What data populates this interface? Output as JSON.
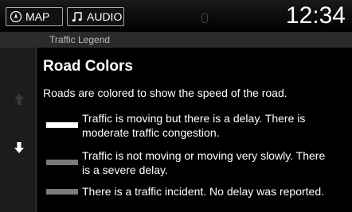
{
  "header": {
    "map_tab": {
      "label": "MAP",
      "icon": "compass-icon"
    },
    "audio_tab": {
      "label": "AUDIO",
      "icon": "music-note-icon"
    },
    "clock": "12:34"
  },
  "breadcrumb": "Traffic Legend",
  "content": {
    "heading": "Road Colors",
    "intro": "Roads are colored to show the speed of the road.",
    "legend": [
      {
        "color": "#ffffff",
        "line1": "Traffic is moving but there is a delay. There is",
        "line2": "moderate traffic congestion."
      },
      {
        "color": "#7a7a7a",
        "line1": "Traffic is not moving or moving very slowly. There",
        "line2": "is a severe delay."
      },
      {
        "color": "#7a7a7a",
        "line1": "There is a traffic incident. No delay was reported.",
        "line2": ""
      }
    ]
  },
  "scroll": {
    "up_icon": "arrow-up-icon",
    "down_icon": "arrow-down-icon"
  }
}
